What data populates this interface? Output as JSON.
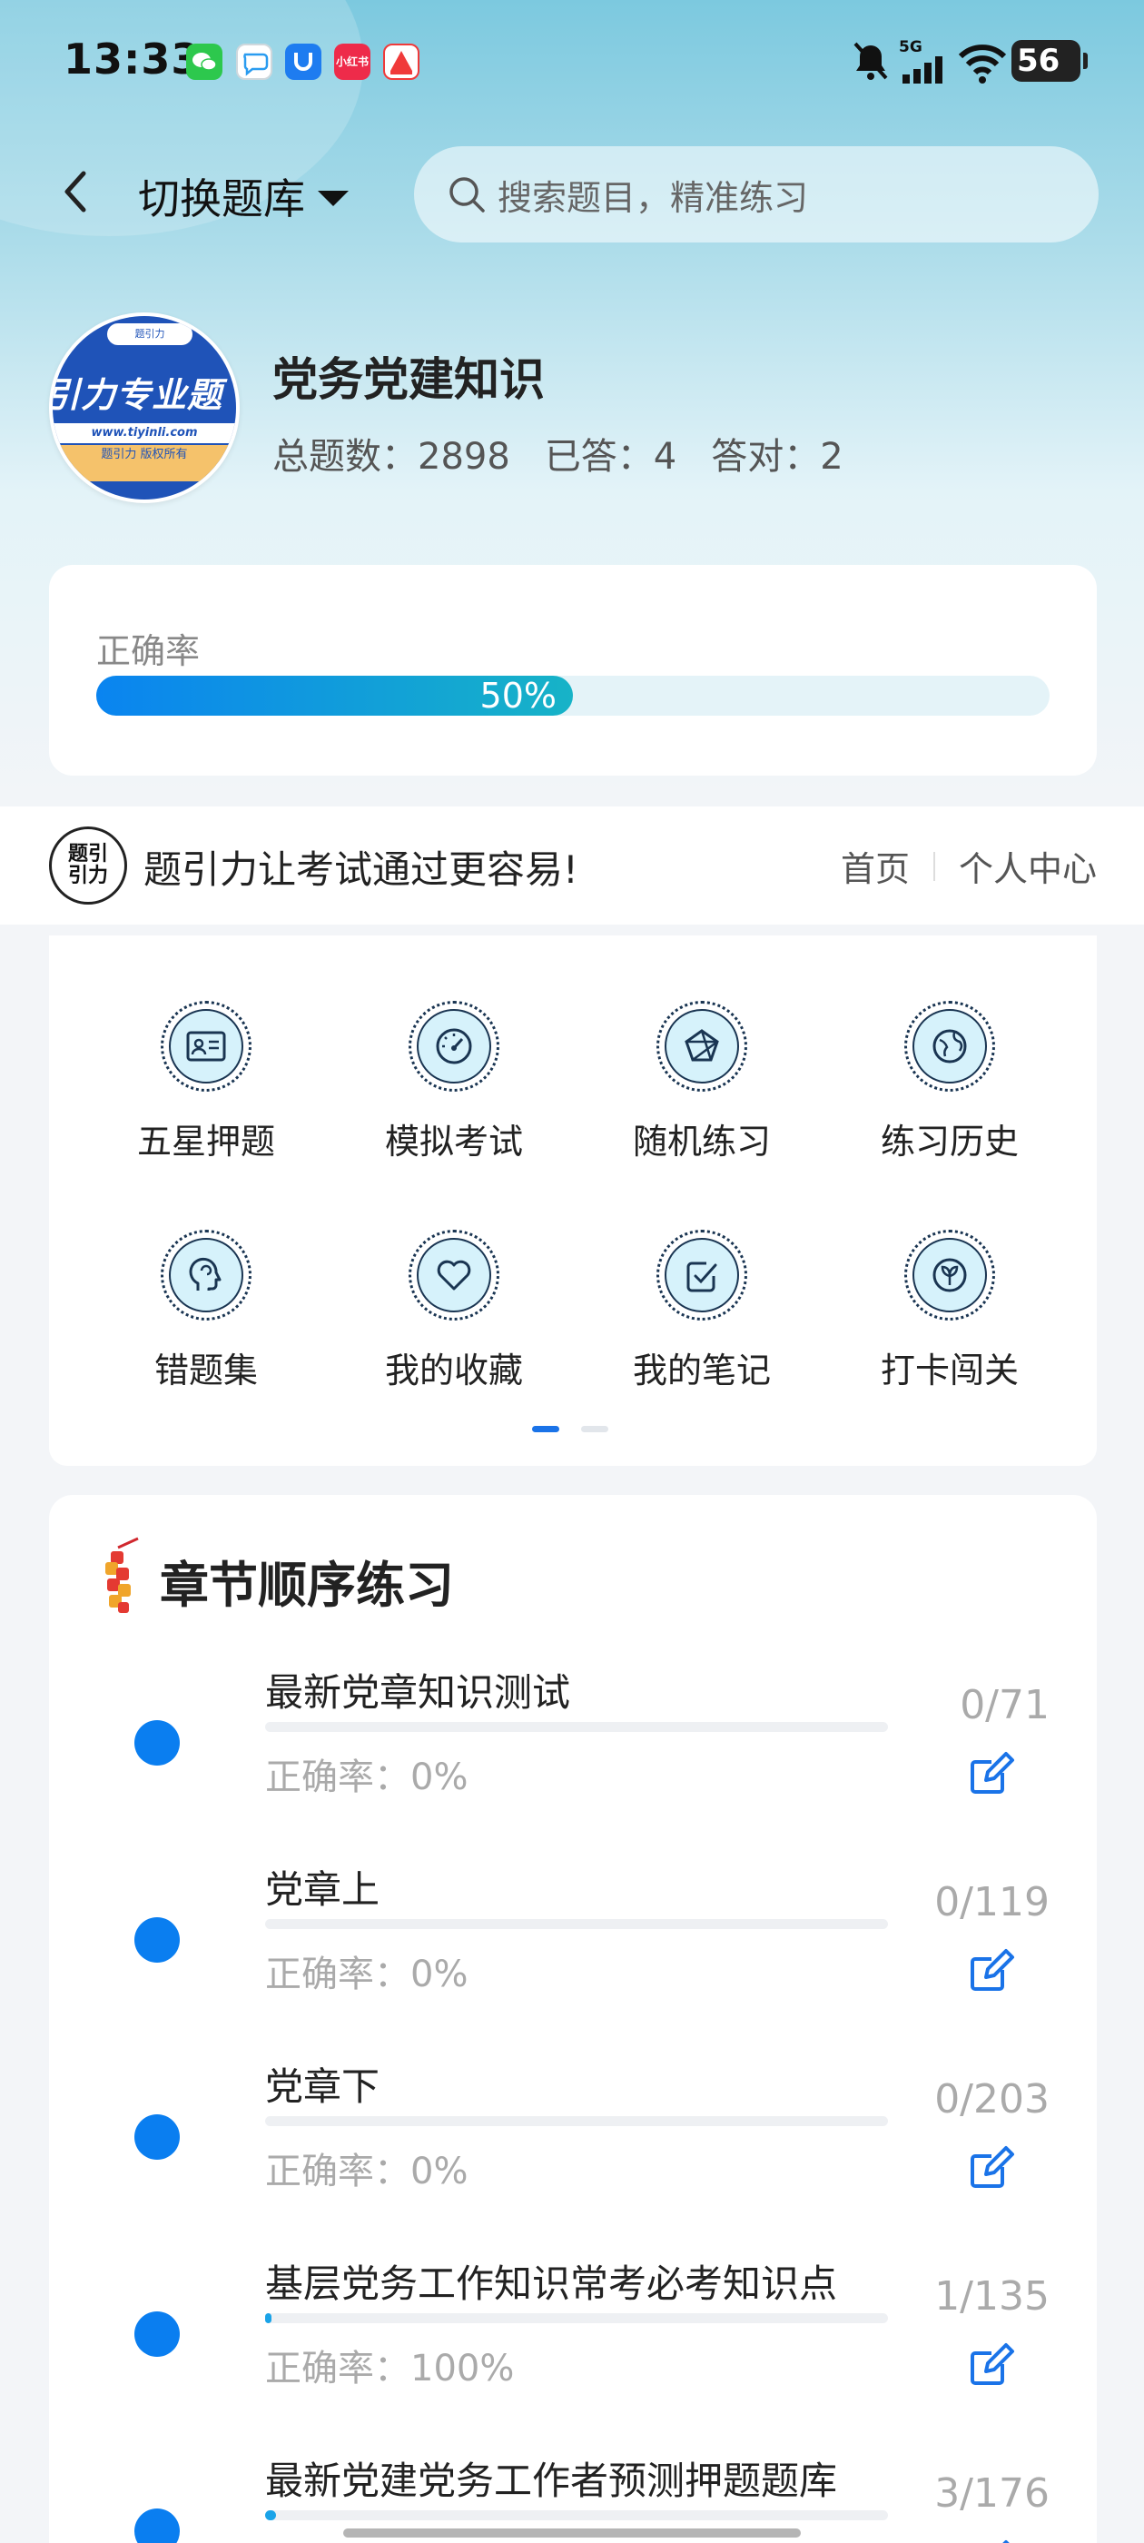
{
  "status_bar": {
    "time": "13:33",
    "apps": [
      {
        "name": "wechat-icon",
        "label": "",
        "color": "#2dc84d"
      },
      {
        "name": "chat-bubble-icon",
        "label": "",
        "color": "#ffffff"
      },
      {
        "name": "shield-app-icon",
        "label": "",
        "color": "#1e7cf0"
      },
      {
        "name": "xiaohongshu-icon",
        "label": "小红书",
        "color": "#ee2b4a"
      },
      {
        "name": "study-app-icon",
        "label": "",
        "color": "#f03a3a"
      }
    ],
    "signal_label": "5G",
    "battery": "56"
  },
  "top_nav": {
    "switch_label": "切换题库",
    "search_placeholder": "搜索题目，精准练习"
  },
  "bank": {
    "title": "党务党建知识",
    "stats": [
      {
        "label": "总题数：",
        "value": "2898"
      },
      {
        "label": "已答：",
        "value": "4"
      },
      {
        "label": "答对：",
        "value": "2"
      }
    ],
    "logo": {
      "top_text": "题引力",
      "main_text": "引力专业题",
      "url": "www.tiyinli.com",
      "copyright": "题引力 版权所有"
    }
  },
  "accuracy": {
    "label": "正确率",
    "text": "50%",
    "value": 0.5
  },
  "banner": {
    "logo_text_1": "题引",
    "logo_text_2": "引力",
    "slogan": "题引力让考试通过更容易!",
    "links": [
      "首页",
      "个人中心"
    ]
  },
  "features": [
    {
      "label": "五星押题",
      "icon": "id-card-icon"
    },
    {
      "label": "模拟考试",
      "icon": "speedometer-icon"
    },
    {
      "label": "随机练习",
      "icon": "network-icon"
    },
    {
      "label": "练习历史",
      "icon": "globe-icon"
    },
    {
      "label": "错题集",
      "icon": "head-brain-icon"
    },
    {
      "label": "我的收藏",
      "icon": "heart-icon"
    },
    {
      "label": "我的笔记",
      "icon": "checkbox-icon"
    },
    {
      "label": "打卡闯关",
      "icon": "leaf-badge-icon"
    }
  ],
  "pager": {
    "pages": 2,
    "active": 0
  },
  "chapters": {
    "title": "章节顺序练习",
    "items": [
      {
        "name": "最新党章知识测试",
        "count": "0/71",
        "rate": "正确率：0%",
        "progress": 0.0
      },
      {
        "name": "党章上",
        "count": "0/119",
        "rate": "正确率：0%",
        "progress": 0.0
      },
      {
        "name": "党章下",
        "count": "0/203",
        "rate": "正确率：0%",
        "progress": 0.0
      },
      {
        "name": "基层党务工作知识常考必考知识点",
        "count": "1/135",
        "rate": "正确率：100%",
        "progress": 0.0074
      },
      {
        "name": "最新党建党务工作者预测押题题库",
        "count": "3/176",
        "rate": "",
        "progress": 0.017
      }
    ]
  },
  "colors": {
    "accent": "#0a7ef0",
    "header_gradient_top": "#7cc9df",
    "progress_start": "#0a84f0",
    "progress_end": "#17b3c7"
  }
}
